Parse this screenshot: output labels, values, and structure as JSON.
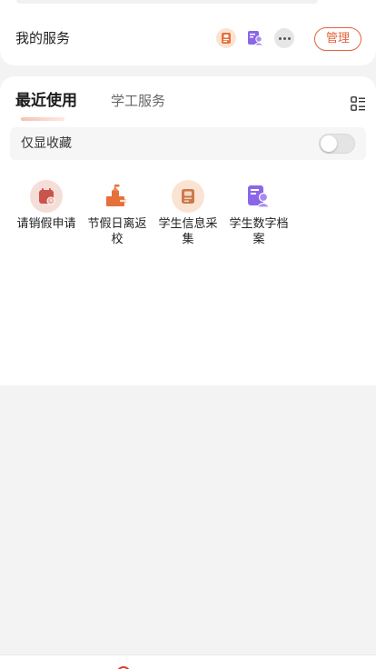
{
  "my_services": {
    "title": "我的服务",
    "quick_icons": [
      "student-info-icon",
      "student-archive-icon",
      "more-icon"
    ],
    "manage_label": "管理"
  },
  "tabs": [
    {
      "label": "最近使用",
      "active": true
    },
    {
      "label": "学工服务",
      "active": false
    }
  ],
  "favorites_toggle": {
    "label": "仅显收藏",
    "on": false
  },
  "apps": [
    {
      "label": "请销假申请",
      "icon": "leave-request-icon"
    },
    {
      "label": "节假日离返校",
      "icon": "holiday-return-icon"
    },
    {
      "label": "学生信息采集",
      "icon": "student-info-icon"
    },
    {
      "label": "学生数字档案",
      "icon": "student-archive-icon"
    }
  ],
  "colors": {
    "accent": "#e4643a",
    "icon_orange": "#e5703a",
    "icon_purple": "#8b66e8",
    "icon_red": "#c9544b"
  }
}
